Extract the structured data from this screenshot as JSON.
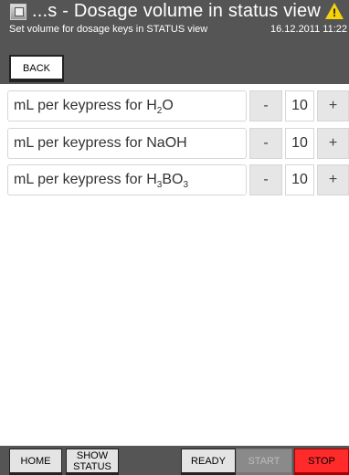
{
  "header": {
    "title": "...s - Dosage volume in status view",
    "subtitle": "Set volume for dosage keys in STATUS view",
    "datetime": "16.12.2011 11:22",
    "icon": "app-icon",
    "warning_icon": "warning-icon"
  },
  "toolbar": {
    "back_label": "BACK"
  },
  "rows": [
    {
      "label_prefix": "mL per keypress for ",
      "substance_base": "H",
      "sub1": "2",
      "substance_rest": "O",
      "sub2": "",
      "value": "10",
      "minus": "-",
      "plus": "+"
    },
    {
      "label_prefix": "mL per keypress for ",
      "substance_base": "NaOH",
      "sub1": "",
      "substance_rest": "",
      "sub2": "",
      "value": "10",
      "minus": "-",
      "plus": "+"
    },
    {
      "label_prefix": "mL per keypress for ",
      "substance_base": "H",
      "sub1": "3",
      "substance_rest": "BO",
      "sub2": "3",
      "value": "10",
      "minus": "-",
      "plus": "+"
    }
  ],
  "footer": {
    "home_label": "HOME",
    "show_status_line1": "SHOW",
    "show_status_line2": "STATUS",
    "ready_label": "READY",
    "start_label": "START",
    "stop_label": "STOP"
  },
  "colors": {
    "bar": "#555555",
    "stop": "#ff2a2a",
    "warning": "#f5d20a"
  }
}
